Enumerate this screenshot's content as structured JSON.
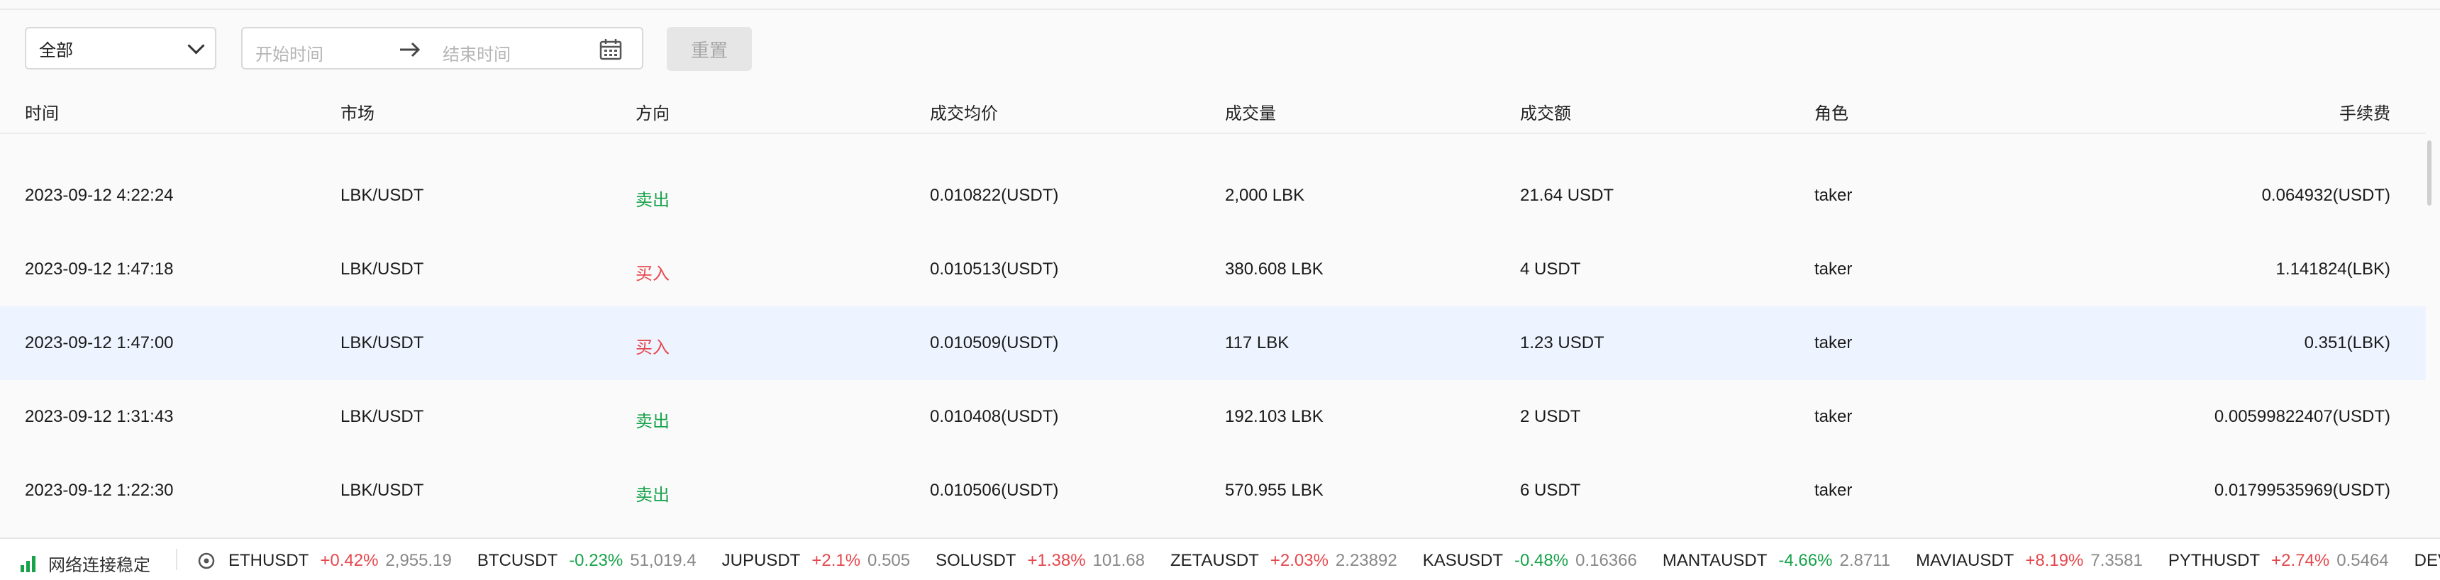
{
  "filters": {
    "market_select": "全部",
    "start_placeholder": "开始时间",
    "end_placeholder": "结束时间",
    "reset_label": "重置"
  },
  "table": {
    "headers": [
      "时间",
      "市场",
      "方向",
      "成交均价",
      "成交量",
      "成交额",
      "角色",
      "手续费"
    ],
    "rows": [
      [
        "2023-09-12 4:22:24",
        "LBK/USDT",
        "卖出",
        "0.010822(USDT)",
        "2,000 LBK",
        "21.64 USDT",
        "taker",
        "0.064932(USDT)"
      ],
      [
        "2023-09-12 1:47:18",
        "LBK/USDT",
        "买入",
        "0.010513(USDT)",
        "380.608 LBK",
        "4 USDT",
        "taker",
        "1.141824(LBK)"
      ],
      [
        "2023-09-12 1:47:00",
        "LBK/USDT",
        "买入",
        "0.010509(USDT)",
        "117 LBK",
        "1.23 USDT",
        "taker",
        "0.351(LBK)"
      ],
      [
        "2023-09-12 1:31:43",
        "LBK/USDT",
        "卖出",
        "0.010408(USDT)",
        "192.103 LBK",
        "2 USDT",
        "taker",
        "0.00599822407(USDT)"
      ],
      [
        "2023-09-12 1:22:30",
        "LBK/USDT",
        "卖出",
        "0.010506(USDT)",
        "570.955 LBK",
        "6 USDT",
        "taker",
        "0.01799535969(USDT)"
      ]
    ]
  },
  "status": {
    "connection": "网络连接稳定",
    "ticker": [
      {
        "symbol": "ETHUSDT",
        "change": "+0.42%",
        "price": "2,955.19",
        "dir": "up"
      },
      {
        "symbol": "BTCUSDT",
        "change": "-0.23%",
        "price": "51,019.4",
        "dir": "down"
      },
      {
        "symbol": "JUPUSDT",
        "change": "+2.1%",
        "price": "0.505",
        "dir": "up"
      },
      {
        "symbol": "SOLUSDT",
        "change": "+1.38%",
        "price": "101.68",
        "dir": "up"
      },
      {
        "symbol": "ZETAUSDT",
        "change": "+2.03%",
        "price": "2.23892",
        "dir": "up"
      },
      {
        "symbol": "KASUSDT",
        "change": "-0.48%",
        "price": "0.16366",
        "dir": "down"
      },
      {
        "symbol": "MANTAUSDT",
        "change": "-4.66%",
        "price": "2.8711",
        "dir": "down"
      },
      {
        "symbol": "MAVIAUSDT",
        "change": "+8.19%",
        "price": "7.3581",
        "dir": "up"
      },
      {
        "symbol": "PYTHUSDT",
        "change": "+2.74%",
        "price": "0.5464",
        "dir": "up"
      },
      {
        "symbol": "DEVVEUS",
        "change": "",
        "price": "",
        "dir": "up"
      }
    ]
  }
}
